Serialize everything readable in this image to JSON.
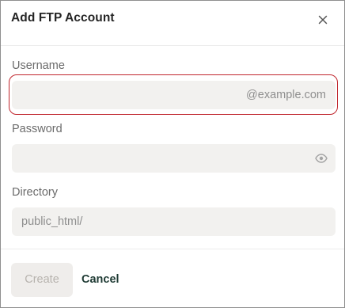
{
  "dialog": {
    "title": "Add FTP Account",
    "close_icon": "close-icon"
  },
  "fields": {
    "username": {
      "label": "Username",
      "value": "",
      "placeholder": "",
      "suffix": "@example.com",
      "focused": true,
      "focus_color": "#c0262d"
    },
    "password": {
      "label": "Password",
      "value": "",
      "placeholder": "",
      "icon": "eye-icon"
    },
    "directory": {
      "label": "Directory",
      "value": "",
      "placeholder": "public_html/"
    }
  },
  "footer": {
    "create_label": "Create",
    "create_disabled": true,
    "cancel_label": "Cancel"
  },
  "colors": {
    "input_bg": "#f2f1ef",
    "accent_text": "#1f3b34"
  }
}
